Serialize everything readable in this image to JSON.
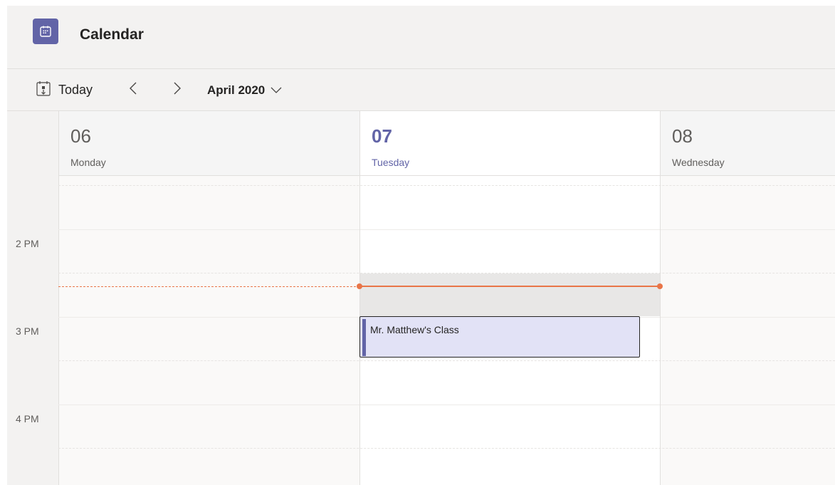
{
  "app": {
    "title": "Calendar",
    "icon": "calendar-icon",
    "accent_color": "#6264a7"
  },
  "toolbar": {
    "today_label": "Today",
    "today_icon": "calendar-today-icon",
    "prev_icon": "chevron-left-icon",
    "next_icon": "chevron-right-icon",
    "month_label": "April 2020",
    "month_dropdown_icon": "chevron-down-icon"
  },
  "days": [
    {
      "number": "06",
      "name": "Monday",
      "is_today": false
    },
    {
      "number": "07",
      "name": "Tuesday",
      "is_today": true
    },
    {
      "number": "08",
      "name": "Wednesday",
      "is_today": false
    }
  ],
  "time_labels": [
    "2 PM",
    "3 PM",
    "4 PM"
  ],
  "current_time_indicator_color": "#e97548",
  "events": [
    {
      "title": "Mr. Matthew's Class",
      "day": "Tuesday",
      "color": "#6264a7"
    }
  ]
}
